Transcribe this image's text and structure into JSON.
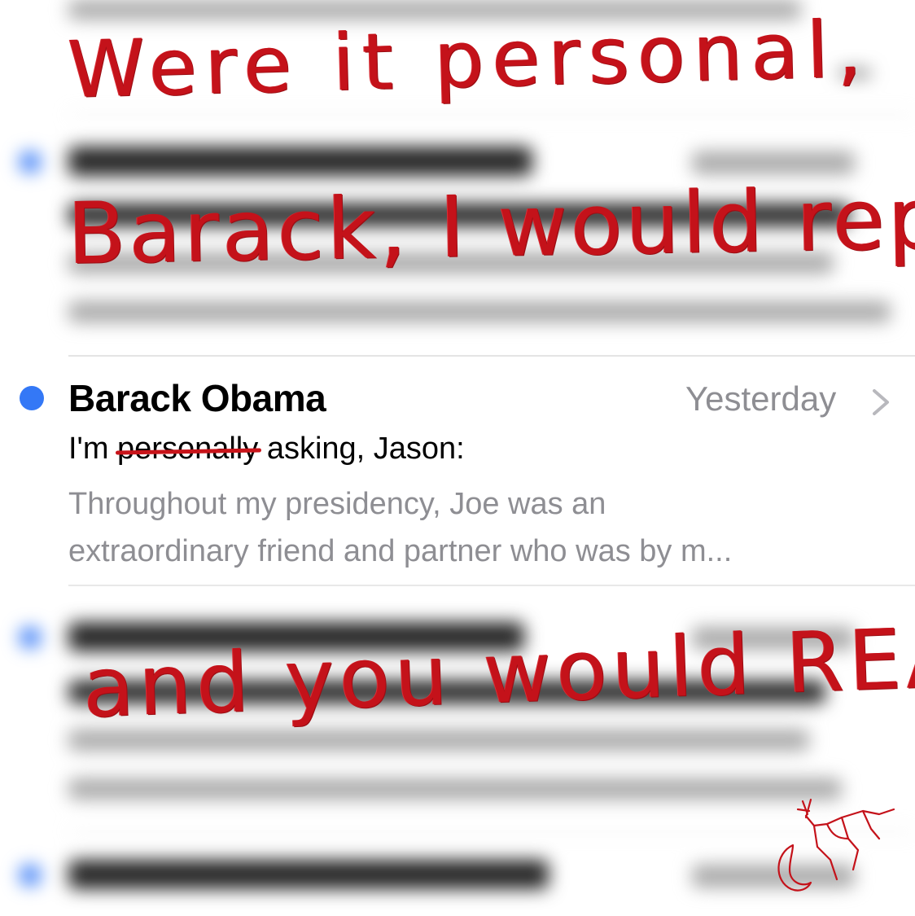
{
  "mail_row": {
    "sender": "Barack Obama",
    "date": "Yesterday",
    "subject_prefix": "I'm",
    "subject_struck": "personally",
    "subject_suffix": "asking, Jason:",
    "preview_line1": "Throughout my presidency, Joe was an",
    "preview_line2": "extraordinary friend and partner who was by m..."
  },
  "annotation": {
    "line1": "Were it personal,",
    "line2": "Barack, I would reply...",
    "line3": "and you would READ it."
  },
  "colors": {
    "unread_dot": "#3478f6",
    "annotation_red": "#c4121a",
    "secondary_text": "#8e8e93"
  },
  "icons": {
    "chevron": "chevron-right-icon",
    "signature": "signature-doodle-icon"
  }
}
